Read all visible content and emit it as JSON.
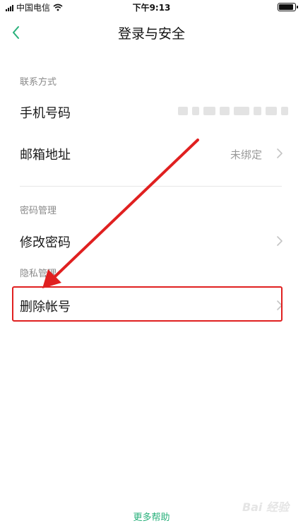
{
  "status_bar": {
    "carrier": "中国电信",
    "time": "下午9:13"
  },
  "nav": {
    "title": "登录与安全"
  },
  "sections": {
    "contact": {
      "header": "联系方式",
      "phone_label": "手机号码",
      "email_label": "邮箱地址",
      "email_value": "未绑定"
    },
    "password": {
      "header": "密码管理",
      "change_label": "修改密码"
    },
    "privacy": {
      "header": "隐私管理",
      "delete_label": "删除帐号"
    }
  },
  "footer": {
    "more_help": "更多帮助"
  },
  "watermark": {
    "text": "Bai 经验"
  },
  "colors": {
    "accent": "#27b07a",
    "annotation": "#e02020"
  }
}
